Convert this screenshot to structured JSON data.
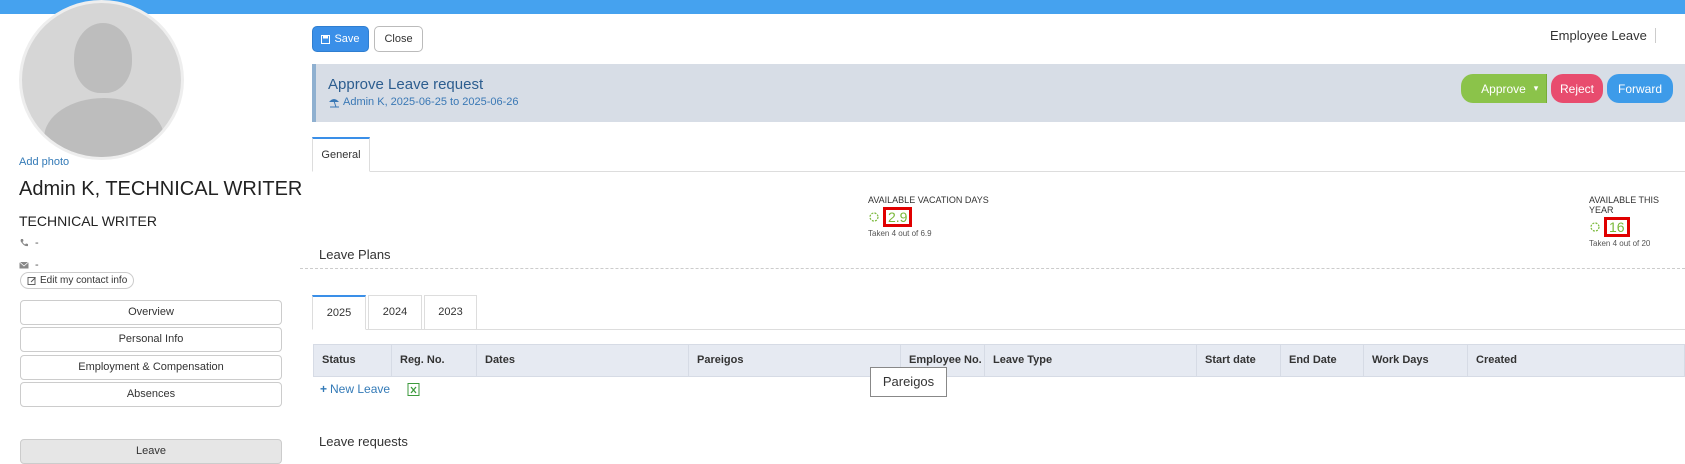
{
  "header": {
    "page_label": "Employee Leave",
    "save_label": "Save",
    "close_label": "Close"
  },
  "profile": {
    "add_photo": "Add photo",
    "name": "Admin K, TECHNICAL WRITER",
    "title": "TECHNICAL WRITER",
    "phone": "-",
    "email": "-",
    "edit_contact": "Edit my contact info"
  },
  "nav": {
    "items": [
      {
        "label": "Overview"
      },
      {
        "label": "Personal Info"
      },
      {
        "label": "Employment & Compensation"
      },
      {
        "label": "Absences"
      },
      {
        "label": "Leave"
      }
    ]
  },
  "approval": {
    "title": "Approve Leave request",
    "subtitle": "Admin K, 2025-06-25 to 2025-06-26",
    "approve": "Approve",
    "reject": "Reject",
    "forward": "Forward"
  },
  "tabs": {
    "general": "General"
  },
  "stats": {
    "vacation": {
      "label": "AVAILABLE VACATION DAYS",
      "value": "2.9",
      "sub": "Taken 4 out of 6.9"
    },
    "year": {
      "label": "AVAILABLE THIS YEAR",
      "value": "16",
      "sub": "Taken 4 out of 20"
    }
  },
  "leave_plans": {
    "title": "Leave Plans",
    "years": [
      "2025",
      "2024",
      "2023"
    ],
    "columns": [
      "Status",
      "Reg. No.",
      "Dates",
      "Pareigos",
      "Employee No.",
      "Leave Type",
      "Start date",
      "End Date",
      "Work Days",
      "Created"
    ],
    "new_leave": "New Leave",
    "tooltip": "Pareigos"
  },
  "leave_requests": {
    "title": "Leave requests"
  },
  "colors": {
    "accent": "#3a8fe8",
    "approve": "#8bc34a",
    "reject": "#e84c6e",
    "topbar": "#45a2ef"
  }
}
